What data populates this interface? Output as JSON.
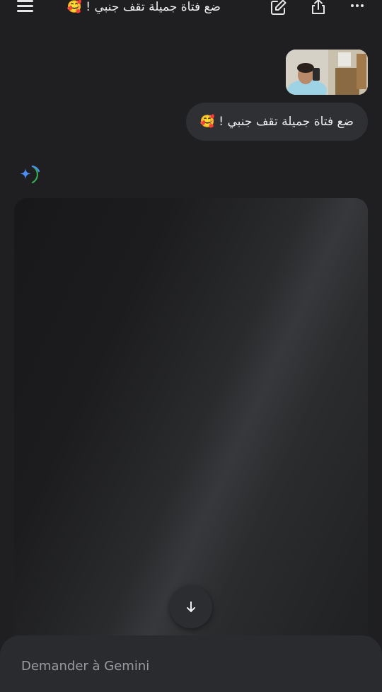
{
  "header": {
    "title": "ضع فتاة جميلة تقف جنبي ! 🥰",
    "menu_icon": "hamburger-menu-icon",
    "edit_icon": "edit-icon",
    "share_icon": "share-icon",
    "more_icon": "more-horizontal-icon"
  },
  "conversation": {
    "user_message": "ضع فتاة جميلة تقف جنبي ! 🥰",
    "assistant_icon": "gemini-spark-icon"
  },
  "scroll_button_icon": "arrow-down-icon",
  "composer": {
    "placeholder": "Demander à Gemini"
  },
  "colors": {
    "background": "#1f1f21",
    "bubble": "#2f3033",
    "composer": "#2a2b2e",
    "gemini_blue": "#4a8df6",
    "gemini_green": "#34a853"
  }
}
